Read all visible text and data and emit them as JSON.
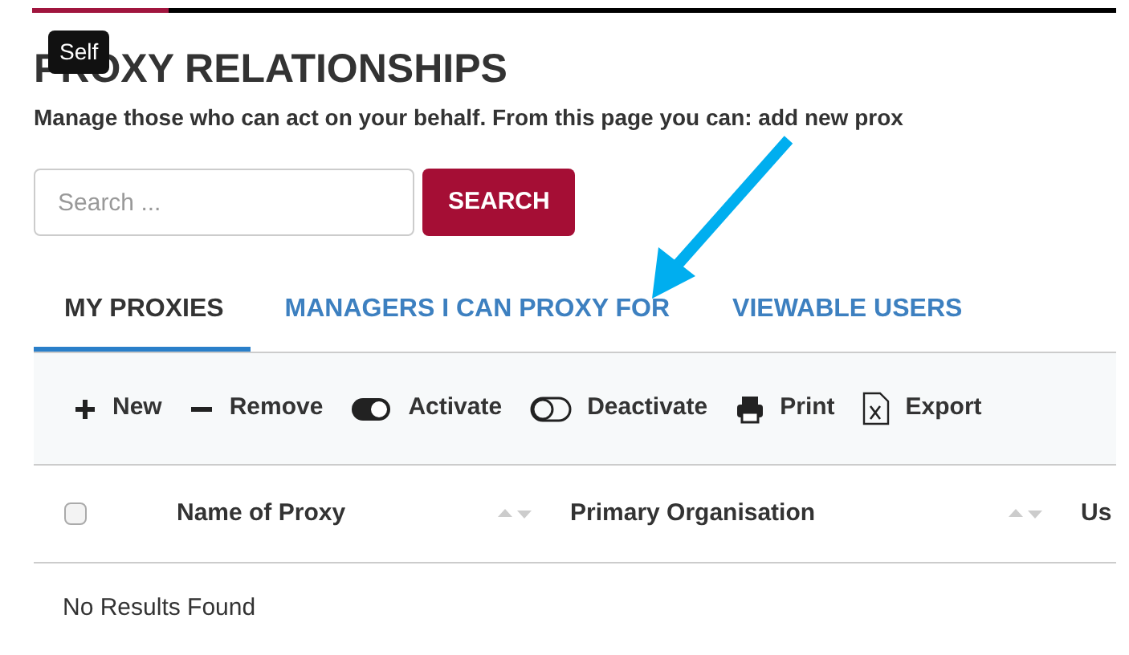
{
  "tooltip": "Self",
  "title": "PROXY RELATIONSHIPS",
  "description": "Manage those who can act on your behalf. From this page you can: add new prox",
  "search": {
    "placeholder": "Search ...",
    "button": "SEARCH"
  },
  "tabs": [
    {
      "label": "MY PROXIES",
      "selected": true
    },
    {
      "label": "MANAGERS I CAN PROXY FOR",
      "selected": false
    },
    {
      "label": "VIEWABLE USERS",
      "selected": false
    }
  ],
  "toolbar": [
    {
      "kind": "plus",
      "label": "New"
    },
    {
      "kind": "minus",
      "label": "Remove"
    },
    {
      "kind": "toggle-on",
      "label": "Activate"
    },
    {
      "kind": "toggle-off",
      "label": "Deactivate"
    },
    {
      "kind": "print",
      "label": "Print"
    },
    {
      "kind": "excel",
      "label": "Export"
    }
  ],
  "table": {
    "select_all": {
      "checked": false
    },
    "columns": [
      {
        "label": "Name of Proxy",
        "sortable": true
      },
      {
        "label": "Primary Organisation",
        "sortable": true
      },
      {
        "label": "Us",
        "sortable": false
      }
    ],
    "empty_message": "No Results Found"
  }
}
